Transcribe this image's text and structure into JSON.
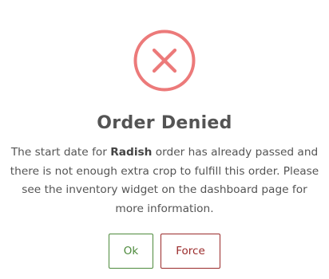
{
  "dialog": {
    "title": "Order Denied",
    "message_prefix": "The start date for ",
    "crop_name": "Radish",
    "message_suffix": " order has already passed and there is not enough extra crop to fulfill this order. Please see the inventory widget on the dashboard page for more information.",
    "icon": "error-x-icon",
    "icon_color": "#ec7a7a",
    "buttons": {
      "ok_label": "Ok",
      "ok_color": "#4d8a3c",
      "force_label": "Force",
      "force_color": "#9a2a2a"
    }
  }
}
